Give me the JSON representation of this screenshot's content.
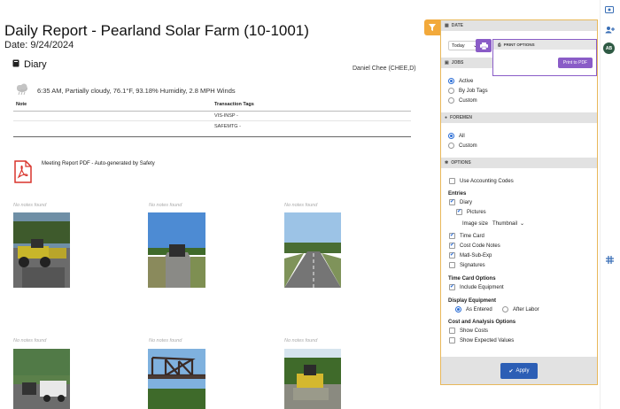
{
  "report": {
    "title": "Daily Report - Pearland Solar Farm (10-1001)",
    "date": "Date: 9/24/2024",
    "section": "Diary",
    "author": "Daniel Chee (CHEE,D)",
    "weather": "6:35 AM, Partially cloudy, 76.1°F, 93.18% Humidity, 2.8 MPH Winds",
    "table": {
      "headers": [
        "Note",
        "Transaction Tags"
      ],
      "rows": [
        [
          "",
          "VIS-INSP -"
        ],
        [
          "",
          "SAFEMTG -"
        ]
      ]
    },
    "pdf_label": "Meeting Report PDF - Auto-generated by Safety",
    "no_notes": "No notes found"
  },
  "filter": {
    "date": {
      "header": "DATE",
      "value": "Today"
    },
    "print": {
      "header": "PRINT OPTIONS",
      "button": "Print to PDF"
    },
    "jobs": {
      "header": "JOBS",
      "options": [
        "Active",
        "By Job Tags",
        "Custom"
      ],
      "selected": 0
    },
    "foremen": {
      "header": "FOREMEN",
      "options": [
        "All",
        "Custom"
      ],
      "selected": 0
    },
    "options": {
      "header": "OPTIONS",
      "use_accounting_codes": "Use Accounting Codes",
      "entries_label": "Entries",
      "diary": "Diary",
      "pictures": "Pictures",
      "image_size_label": "Image size",
      "image_size_value": "Thumbnail",
      "time_card": "Time Card",
      "cost_code_notes": "Cost Code Notes",
      "matl_sub_exp": "Matl-Sub-Exp",
      "signatures": "Signatures",
      "time_card_options_label": "Time Card Options",
      "include_equipment": "Include Equipment",
      "display_equipment_label": "Display Equipment",
      "as_entered": "As Entered",
      "after_labor": "After Labor",
      "cost_analysis_label": "Cost and Analysis Options",
      "show_costs": "Show Costs",
      "show_expected_values": "Show Expected Values"
    },
    "apply": "Apply"
  },
  "user": {
    "initials": "AB"
  },
  "colors": {
    "accent": "#8a5cc7",
    "filter_tab": "#f2a93b",
    "apply": "#2c5eb5",
    "pdf_red": "#d9332b"
  }
}
